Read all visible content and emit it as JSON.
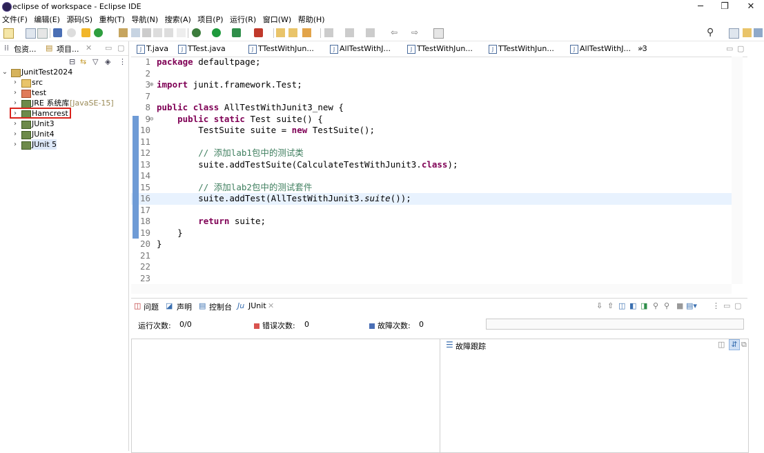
{
  "window": {
    "title": "eclipse of workspace - Eclipse IDE",
    "controls": {
      "minimize": "─",
      "maximize": "❐",
      "close": "✕"
    }
  },
  "menu": [
    "文件(F)",
    "编辑(E)",
    "源码(S)",
    "重构(T)",
    "导航(N)",
    "搜索(A)",
    "项目(P)",
    "运行(R)",
    "窗口(W)",
    "帮助(H)"
  ],
  "left_panel": {
    "tabs": [
      {
        "label": "包资..."
      },
      {
        "label": "项目..."
      }
    ],
    "tree": [
      {
        "label": "JunitTest2024",
        "expanded": true
      },
      {
        "label": "src"
      },
      {
        "label": "test"
      },
      {
        "label": "JRE 系统库",
        "suffix": "[JavaSE-15]"
      },
      {
        "label": "Hamcrest",
        "highlighted": true
      },
      {
        "label": "JUnit3"
      },
      {
        "label": "JUnit4"
      },
      {
        "label": "JUnit 5"
      }
    ]
  },
  "editor": {
    "tabs": [
      {
        "label": "T.java"
      },
      {
        "label": "TTest.java"
      },
      {
        "label": "TTestWithJun..."
      },
      {
        "label": "AllTestWithJ..."
      },
      {
        "label": "TTestWithJun..."
      },
      {
        "label": "TTestWithJun..."
      },
      {
        "label": "AllTestWithJ...",
        "active": true
      }
    ],
    "overflow": "»3",
    "lines": [
      {
        "n": "1",
        "fold": "",
        "parts": [
          [
            "kw",
            "package"
          ],
          [
            "",
            " defaultpage;"
          ]
        ]
      },
      {
        "n": "2",
        "fold": "",
        "parts": []
      },
      {
        "n": "3",
        "fold": "⊕",
        "parts": [
          [
            "kw",
            "import"
          ],
          [
            "",
            " junit.framework.Test;"
          ]
        ]
      },
      {
        "n": "7",
        "fold": "",
        "parts": []
      },
      {
        "n": "8",
        "fold": "",
        "parts": [
          [
            "kw",
            "public"
          ],
          [
            "",
            " "
          ],
          [
            "kw",
            "class"
          ],
          [
            "",
            " AllTestWithJunit3_new {"
          ]
        ]
      },
      {
        "n": "9",
        "fold": "⊖",
        "parts": [
          [
            "",
            "    "
          ],
          [
            "kw",
            "public"
          ],
          [
            "",
            " "
          ],
          [
            "kw",
            "static"
          ],
          [
            "",
            " Test suite() {"
          ]
        ]
      },
      {
        "n": "10",
        "fold": "",
        "parts": [
          [
            "",
            "        TestSuite suite = "
          ],
          [
            "kw",
            "new"
          ],
          [
            "",
            " TestSuite();"
          ]
        ]
      },
      {
        "n": "11",
        "fold": "",
        "parts": []
      },
      {
        "n": "12",
        "fold": "",
        "parts": [
          [
            "",
            "        "
          ],
          [
            "cm",
            "// 添加lab1包中的测试类"
          ]
        ]
      },
      {
        "n": "13",
        "fold": "",
        "parts": [
          [
            "",
            "        suite.addTestSuite(CalculateTestWithJunit3."
          ],
          [
            "kw",
            "class"
          ],
          [
            "",
            ");"
          ]
        ]
      },
      {
        "n": "14",
        "fold": "",
        "parts": []
      },
      {
        "n": "15",
        "fold": "",
        "parts": [
          [
            "",
            "        "
          ],
          [
            "cm",
            "// 添加lab2包中的测试套件"
          ]
        ]
      },
      {
        "n": "16",
        "fold": "",
        "current": true,
        "parts": [
          [
            "",
            "        suite.addTest(AllTestWithJunit3."
          ],
          [
            "it",
            "suite"
          ],
          [
            "",
            "());"
          ]
        ]
      },
      {
        "n": "17",
        "fold": "",
        "parts": []
      },
      {
        "n": "18",
        "fold": "",
        "parts": [
          [
            "",
            "        "
          ],
          [
            "kw",
            "return"
          ],
          [
            "",
            " suite;"
          ]
        ]
      },
      {
        "n": "19",
        "fold": "",
        "parts": [
          [
            "",
            "    }"
          ]
        ]
      },
      {
        "n": "20",
        "fold": "",
        "parts": [
          [
            "",
            "}"
          ]
        ]
      },
      {
        "n": "21",
        "fold": "",
        "parts": []
      },
      {
        "n": "22",
        "fold": "",
        "parts": []
      },
      {
        "n": "23",
        "fold": "",
        "parts": []
      }
    ]
  },
  "bottom_panel": {
    "tabs": [
      {
        "label": "问题"
      },
      {
        "label": "声明"
      },
      {
        "label": "控制台"
      },
      {
        "label": "JUnit",
        "active": true
      }
    ],
    "runs_label": "运行次数:",
    "runs_value": "0/0",
    "errors_label": "错误次数:",
    "errors_value": "0",
    "failures_label": "故障次数:",
    "failures_value": "0",
    "failure_trace_label": "故障跟踪"
  },
  "colors": {
    "keyword": "#7f0055",
    "comment": "#3f7f5f",
    "current_line": "#e8f2fe",
    "highlight_box": "#d9221b"
  }
}
